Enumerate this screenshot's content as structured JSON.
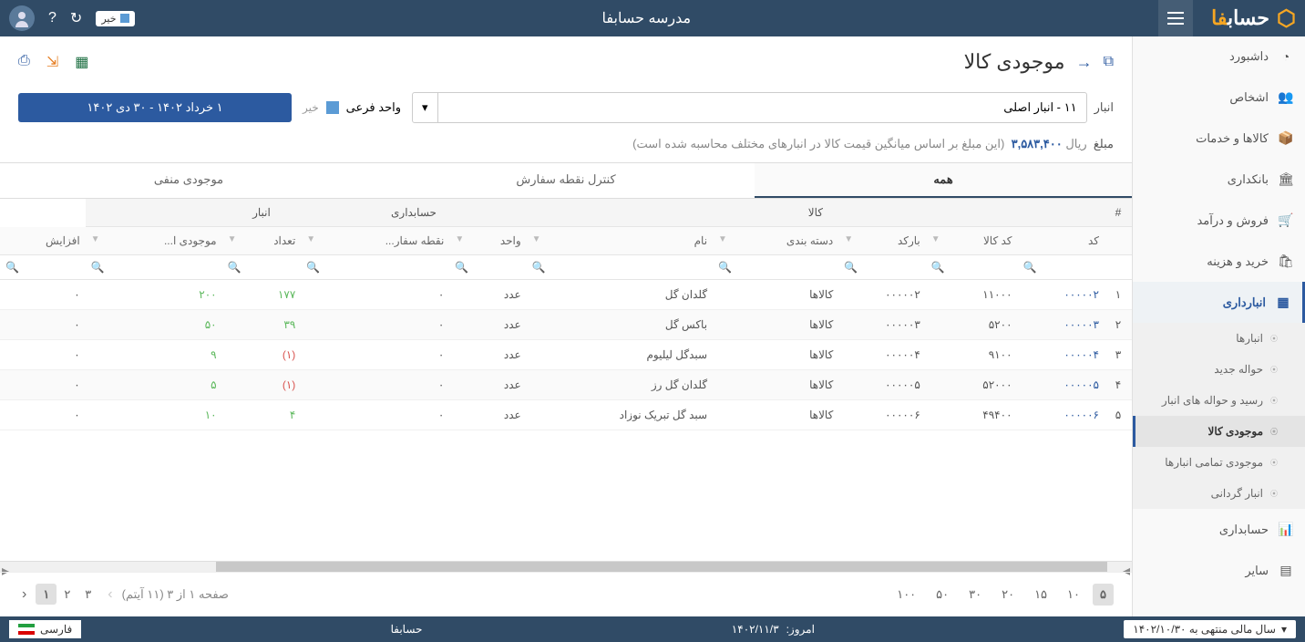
{
  "header": {
    "app_title": "مدرسه حسابفا",
    "logo_text1": "حساب",
    "logo_text2": "فا",
    "khir_badge": "خیر"
  },
  "sidebar": {
    "items": [
      {
        "label": "داشبورد",
        "icon": "dashboard"
      },
      {
        "label": "اشخاص",
        "icon": "people"
      },
      {
        "label": "کالاها و خدمات",
        "icon": "box"
      },
      {
        "label": "بانکداری",
        "icon": "bank"
      },
      {
        "label": "فروش و درآمد",
        "icon": "cart"
      },
      {
        "label": "خرید و هزینه",
        "icon": "bag"
      },
      {
        "label": "انبارداری",
        "icon": "warehouse"
      },
      {
        "label": "حسابداری",
        "icon": "ledger"
      },
      {
        "label": "سایر",
        "icon": "other"
      }
    ],
    "sub_items": [
      {
        "label": "انبارها"
      },
      {
        "label": "حواله جدید"
      },
      {
        "label": "رسید و حواله های انبار"
      },
      {
        "label": "موجودی کالا"
      },
      {
        "label": "موجودی تمامی انبارها"
      },
      {
        "label": "انبار گردانی"
      }
    ]
  },
  "page": {
    "title": "موجودی کالا"
  },
  "filters": {
    "warehouse_label": "انبار",
    "warehouse_value": "۱۱ - انبار اصلی",
    "sub_unit_label": "واحد فرعی",
    "sub_unit_value": "خیر",
    "date_range": "۱ خرداد ۱۴۰۲ - ۳۰ دی ۱۴۰۲"
  },
  "amount": {
    "label": "مبلغ",
    "currency": "ریال",
    "value": "۳,۵۸۳,۴۰۰",
    "note": "(این مبلغ بر اساس میانگین قیمت کالا در انبارهای مختلف محاسبه شده است)"
  },
  "tabs": [
    {
      "label": "همه"
    },
    {
      "label": "کنترل نقطه سفارش"
    },
    {
      "label": "موجودی منفی"
    }
  ],
  "table": {
    "group_headers": [
      "#",
      "کالا",
      "حسابداری",
      "انبار",
      ""
    ],
    "columns": [
      "کد",
      "کد کالا",
      "بارکد",
      "دسته بندی",
      "نام",
      "واحد",
      "نقطه سفار...",
      "تعداد",
      "موجودی ا...",
      "افزایش"
    ],
    "rows": [
      {
        "idx": "۱",
        "code": "۰۰۰۰۰۲",
        "item_code": "۱۱۰۰۰",
        "barcode": "۰۰۰۰۰۲",
        "cat": "کالاها",
        "name": "گلدان گل",
        "unit": "عدد",
        "reorder": "۰",
        "qty": "۱۷۷",
        "qty_cls": "pos",
        "stock": "۲۰۰",
        "stock_cls": "pos",
        "inc": "۰"
      },
      {
        "idx": "۲",
        "code": "۰۰۰۰۰۳",
        "item_code": "۵۲۰۰",
        "barcode": "۰۰۰۰۰۳",
        "cat": "کالاها",
        "name": "باکس گل",
        "unit": "عدد",
        "reorder": "۰",
        "qty": "۳۹",
        "qty_cls": "pos",
        "stock": "۵۰",
        "stock_cls": "pos",
        "inc": "۰"
      },
      {
        "idx": "۳",
        "code": "۰۰۰۰۰۴",
        "item_code": "۹۱۰۰",
        "barcode": "۰۰۰۰۰۴",
        "cat": "کالاها",
        "name": "سبدگل لیلیوم",
        "unit": "عدد",
        "reorder": "۰",
        "qty": "(۱)",
        "qty_cls": "neg",
        "stock": "۹",
        "stock_cls": "pos",
        "inc": "۰"
      },
      {
        "idx": "۴",
        "code": "۰۰۰۰۰۵",
        "item_code": "۵۲۰۰۰",
        "barcode": "۰۰۰۰۰۵",
        "cat": "کالاها",
        "name": "گلدان گل رز",
        "unit": "عدد",
        "reorder": "۰",
        "qty": "(۱)",
        "qty_cls": "neg",
        "stock": "۵",
        "stock_cls": "pos",
        "inc": "۰"
      },
      {
        "idx": "۵",
        "code": "۰۰۰۰۰۶",
        "item_code": "۴۹۴۰۰",
        "barcode": "۰۰۰۰۰۶",
        "cat": "کالاها",
        "name": "سبد گل تبریک نوزاد",
        "unit": "عدد",
        "reorder": "۰",
        "qty": "۴",
        "qty_cls": "pos",
        "stock": "۱۰",
        "stock_cls": "pos",
        "inc": "۰"
      }
    ]
  },
  "pagination": {
    "sizes": [
      "۵",
      "۱۰",
      "۱۵",
      "۲۰",
      "۳۰",
      "۵۰",
      "۱۰۰"
    ],
    "size_active": "۵",
    "pages": [
      "۱",
      "۲",
      "۳"
    ],
    "page_active": "۱",
    "info": "صفحه ۱ از ۳ (۱۱ آیتم)"
  },
  "footer": {
    "fiscal_year": "سال مالی منتهی به ۱۴۰۲/۱۰/۳۰",
    "today_label": "امروز:",
    "today_value": "۱۴۰۲/۱۱/۳",
    "brand": "حسابفا",
    "lang": "فارسی"
  }
}
